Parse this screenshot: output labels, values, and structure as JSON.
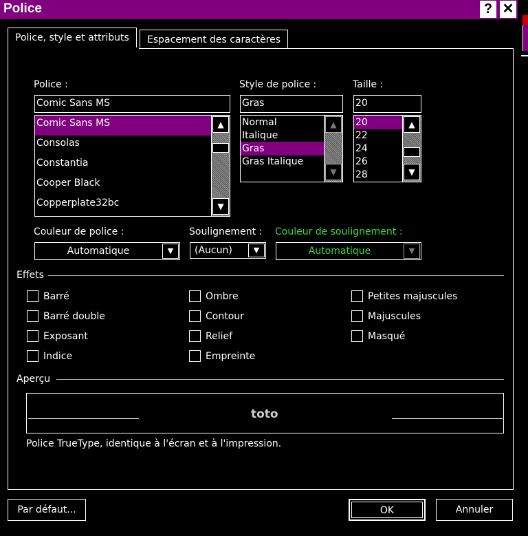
{
  "window": {
    "title": "Police",
    "help_label": "?",
    "close_label": "✕"
  },
  "tabs": [
    {
      "label": "Police, style et attributs",
      "active": true
    },
    {
      "label": "Espacement des caractères",
      "active": false
    }
  ],
  "font": {
    "label": "Police :",
    "value": "Comic Sans MS",
    "items": [
      "Comic Sans MS",
      "Consolas",
      "Constantia",
      "Cooper Black",
      "Copperplate32bc"
    ],
    "selected": "Comic Sans MS"
  },
  "style": {
    "label": "Style de police :",
    "value": "Gras",
    "items": [
      "Normal",
      "Italique",
      "Gras",
      "Gras Italique"
    ],
    "selected": "Gras"
  },
  "size": {
    "label": "Taille :",
    "value": "20",
    "items": [
      "20",
      "22",
      "24",
      "26",
      "28"
    ],
    "selected": "20"
  },
  "font_color": {
    "label": "Couleur de police :",
    "value": "Automatique"
  },
  "underline": {
    "label": "Soulignement :",
    "value": "(Aucun)"
  },
  "underline_color": {
    "label": "Couleur de soulignement :",
    "value": "Automatique",
    "color": "#3cd93c"
  },
  "effects": {
    "label": "Effets",
    "col1": [
      "Barré",
      "Barré double",
      "Exposant",
      "Indice"
    ],
    "col2": [
      "Ombre",
      "Contour",
      "Relief",
      "Empreinte"
    ],
    "col3": [
      "Petites majuscules",
      "Majuscules",
      "Masqué"
    ]
  },
  "preview": {
    "label": "Aperçu",
    "text": "toto",
    "description": "Police TrueType, identique à l'écran et à l'impression."
  },
  "buttons": {
    "default": "Par défaut...",
    "ok": "OK",
    "cancel": "Annuler"
  },
  "colors": {
    "accent": "#800080",
    "background": "#000000",
    "disabled_label": "#3cd93c"
  }
}
